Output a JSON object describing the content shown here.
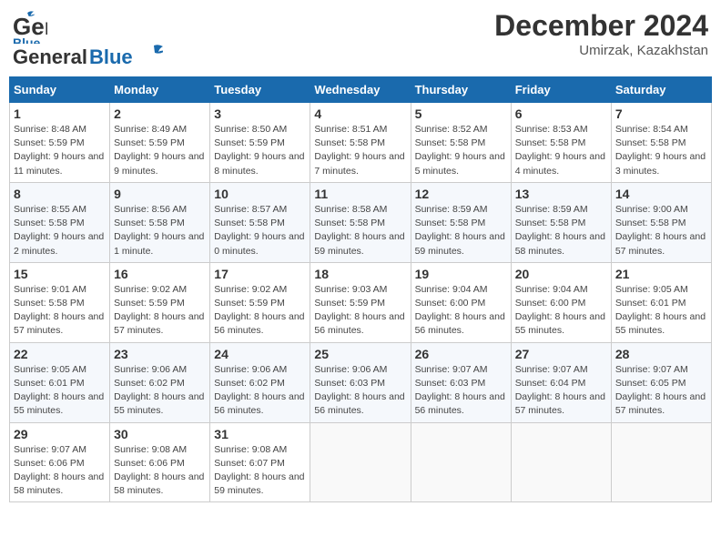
{
  "header": {
    "logo_line1": "General",
    "logo_line2": "Blue",
    "month_title": "December 2024",
    "location": "Umirzak, Kazakhstan"
  },
  "weekdays": [
    "Sunday",
    "Monday",
    "Tuesday",
    "Wednesday",
    "Thursday",
    "Friday",
    "Saturday"
  ],
  "weeks": [
    [
      {
        "day": "1",
        "sunrise": "8:48 AM",
        "sunset": "5:59 PM",
        "daylight": "9 hours and 11 minutes."
      },
      {
        "day": "2",
        "sunrise": "8:49 AM",
        "sunset": "5:59 PM",
        "daylight": "9 hours and 9 minutes."
      },
      {
        "day": "3",
        "sunrise": "8:50 AM",
        "sunset": "5:59 PM",
        "daylight": "9 hours and 8 minutes."
      },
      {
        "day": "4",
        "sunrise": "8:51 AM",
        "sunset": "5:58 PM",
        "daylight": "9 hours and 7 minutes."
      },
      {
        "day": "5",
        "sunrise": "8:52 AM",
        "sunset": "5:58 PM",
        "daylight": "9 hours and 5 minutes."
      },
      {
        "day": "6",
        "sunrise": "8:53 AM",
        "sunset": "5:58 PM",
        "daylight": "9 hours and 4 minutes."
      },
      {
        "day": "7",
        "sunrise": "8:54 AM",
        "sunset": "5:58 PM",
        "daylight": "9 hours and 3 minutes."
      }
    ],
    [
      {
        "day": "8",
        "sunrise": "8:55 AM",
        "sunset": "5:58 PM",
        "daylight": "9 hours and 2 minutes."
      },
      {
        "day": "9",
        "sunrise": "8:56 AM",
        "sunset": "5:58 PM",
        "daylight": "9 hours and 1 minute."
      },
      {
        "day": "10",
        "sunrise": "8:57 AM",
        "sunset": "5:58 PM",
        "daylight": "9 hours and 0 minutes."
      },
      {
        "day": "11",
        "sunrise": "8:58 AM",
        "sunset": "5:58 PM",
        "daylight": "8 hours and 59 minutes."
      },
      {
        "day": "12",
        "sunrise": "8:59 AM",
        "sunset": "5:58 PM",
        "daylight": "8 hours and 59 minutes."
      },
      {
        "day": "13",
        "sunrise": "8:59 AM",
        "sunset": "5:58 PM",
        "daylight": "8 hours and 58 minutes."
      },
      {
        "day": "14",
        "sunrise": "9:00 AM",
        "sunset": "5:58 PM",
        "daylight": "8 hours and 57 minutes."
      }
    ],
    [
      {
        "day": "15",
        "sunrise": "9:01 AM",
        "sunset": "5:58 PM",
        "daylight": "8 hours and 57 minutes."
      },
      {
        "day": "16",
        "sunrise": "9:02 AM",
        "sunset": "5:59 PM",
        "daylight": "8 hours and 57 minutes."
      },
      {
        "day": "17",
        "sunrise": "9:02 AM",
        "sunset": "5:59 PM",
        "daylight": "8 hours and 56 minutes."
      },
      {
        "day": "18",
        "sunrise": "9:03 AM",
        "sunset": "5:59 PM",
        "daylight": "8 hours and 56 minutes."
      },
      {
        "day": "19",
        "sunrise": "9:04 AM",
        "sunset": "6:00 PM",
        "daylight": "8 hours and 56 minutes."
      },
      {
        "day": "20",
        "sunrise": "9:04 AM",
        "sunset": "6:00 PM",
        "daylight": "8 hours and 55 minutes."
      },
      {
        "day": "21",
        "sunrise": "9:05 AM",
        "sunset": "6:01 PM",
        "daylight": "8 hours and 55 minutes."
      }
    ],
    [
      {
        "day": "22",
        "sunrise": "9:05 AM",
        "sunset": "6:01 PM",
        "daylight": "8 hours and 55 minutes."
      },
      {
        "day": "23",
        "sunrise": "9:06 AM",
        "sunset": "6:02 PM",
        "daylight": "8 hours and 55 minutes."
      },
      {
        "day": "24",
        "sunrise": "9:06 AM",
        "sunset": "6:02 PM",
        "daylight": "8 hours and 56 minutes."
      },
      {
        "day": "25",
        "sunrise": "9:06 AM",
        "sunset": "6:03 PM",
        "daylight": "8 hours and 56 minutes."
      },
      {
        "day": "26",
        "sunrise": "9:07 AM",
        "sunset": "6:03 PM",
        "daylight": "8 hours and 56 minutes."
      },
      {
        "day": "27",
        "sunrise": "9:07 AM",
        "sunset": "6:04 PM",
        "daylight": "8 hours and 57 minutes."
      },
      {
        "day": "28",
        "sunrise": "9:07 AM",
        "sunset": "6:05 PM",
        "daylight": "8 hours and 57 minutes."
      }
    ],
    [
      {
        "day": "29",
        "sunrise": "9:07 AM",
        "sunset": "6:06 PM",
        "daylight": "8 hours and 58 minutes."
      },
      {
        "day": "30",
        "sunrise": "9:08 AM",
        "sunset": "6:06 PM",
        "daylight": "8 hours and 58 minutes."
      },
      {
        "day": "31",
        "sunrise": "9:08 AM",
        "sunset": "6:07 PM",
        "daylight": "8 hours and 59 minutes."
      },
      null,
      null,
      null,
      null
    ]
  ]
}
